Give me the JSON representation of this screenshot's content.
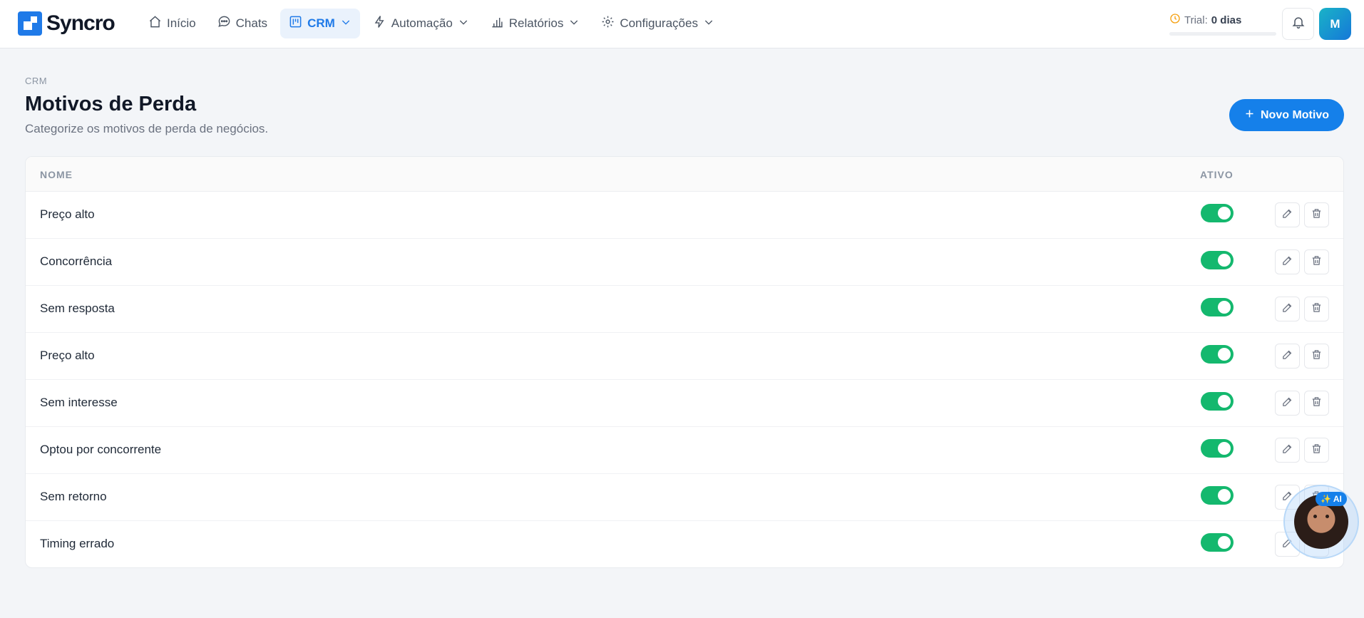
{
  "brand": {
    "name": "Syncro"
  },
  "nav": {
    "items": [
      {
        "label": "Início",
        "icon": "home-icon",
        "dropdown": false,
        "active": false
      },
      {
        "label": "Chats",
        "icon": "chat-icon",
        "dropdown": false,
        "active": false
      },
      {
        "label": "CRM",
        "icon": "kanban-icon",
        "dropdown": true,
        "active": true
      },
      {
        "label": "Automação",
        "icon": "bolt-icon",
        "dropdown": true,
        "active": false
      },
      {
        "label": "Relatórios",
        "icon": "bar-chart-icon",
        "dropdown": true,
        "active": false
      },
      {
        "label": "Configurações",
        "icon": "gear-icon",
        "dropdown": true,
        "active": false
      }
    ]
  },
  "trial": {
    "label": "Trial:",
    "value": "0 dias",
    "progress": 0
  },
  "user": {
    "initial": "M"
  },
  "page": {
    "breadcrumb": "CRM",
    "title": "Motivos de Perda",
    "subtitle": "Categorize os motivos de perda de negócios.",
    "new_button": "Novo Motivo"
  },
  "table": {
    "headers": {
      "name": "NOME",
      "active": "ATIVO"
    },
    "rows": [
      {
        "name": "Preço alto",
        "active": true
      },
      {
        "name": "Concorrência",
        "active": true
      },
      {
        "name": "Sem resposta",
        "active": true
      },
      {
        "name": "Preço alto",
        "active": true
      },
      {
        "name": "Sem interesse",
        "active": true
      },
      {
        "name": "Optou por concorrente",
        "active": true
      },
      {
        "name": "Sem retorno",
        "active": true
      },
      {
        "name": "Timing errado",
        "active": true
      }
    ]
  },
  "assistant": {
    "badge": "✨ AI"
  },
  "colors": {
    "accent": "#1580ea",
    "toggle_on": "#14b86e"
  }
}
